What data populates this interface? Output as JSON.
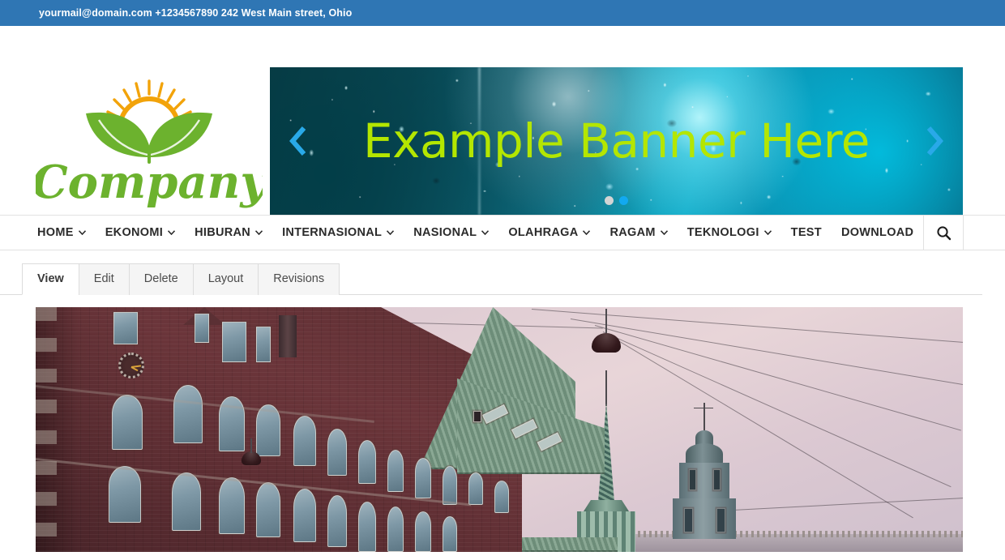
{
  "topbar": {
    "contact": "yourmail@domain.com +1234567890 242 West Main street, Ohio",
    "bg_color": "#2f76b4"
  },
  "logo": {
    "text": "Company",
    "leaf_color": "#6cb22e",
    "sun_color": "#f2a30a",
    "alt": "Company logo — two green leaves with rising sun"
  },
  "banner": {
    "title": "Example Banner Here",
    "title_color": "#b4e600",
    "prev_label": "‹",
    "next_label": "›",
    "arrow_color": "#29a9e8",
    "slides": [
      {
        "label": "Slide 1",
        "active": false
      },
      {
        "label": "Slide 2",
        "active": true
      }
    ],
    "active_dot_color": "#12a9f0",
    "inactive_dot_color": "#d4d4d4"
  },
  "mainnav": {
    "items": [
      {
        "label": "HOME",
        "has_dropdown": true
      },
      {
        "label": "EKONOMI",
        "has_dropdown": true
      },
      {
        "label": "HIBURAN",
        "has_dropdown": true
      },
      {
        "label": "INTERNASIONAL",
        "has_dropdown": true
      },
      {
        "label": "NASIONAL",
        "has_dropdown": true
      },
      {
        "label": "OLAHRAGA",
        "has_dropdown": true
      },
      {
        "label": "RAGAM",
        "has_dropdown": true
      },
      {
        "label": "TEKNOLOGI",
        "has_dropdown": true
      },
      {
        "label": "TEST",
        "has_dropdown": false
      },
      {
        "label": "DOWNLOAD",
        "has_dropdown": false
      }
    ],
    "search_icon": "search-icon"
  },
  "admin_tabs": {
    "items": [
      {
        "label": "View",
        "active": true
      },
      {
        "label": "Edit",
        "active": false
      },
      {
        "label": "Delete",
        "active": false
      },
      {
        "label": "Layout",
        "active": false
      },
      {
        "label": "Revisions",
        "active": false
      }
    ]
  },
  "article": {
    "image_alt": "Red brick historic building with green copper roof, clock tower, twisted spire and palace tower against a pale pink dusk sky, overhead tram wires and a hanging street lamp"
  }
}
